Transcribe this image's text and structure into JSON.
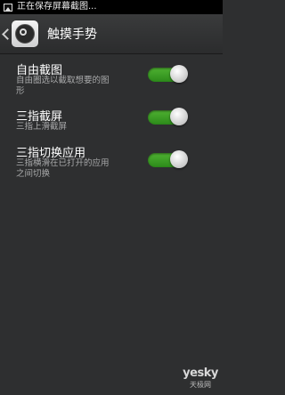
{
  "status_bar": {
    "text": "正在保存屏幕截图..."
  },
  "title_bar": {
    "title": "触摸手势"
  },
  "settings": [
    {
      "title": "自由截图",
      "desc_lines": [
        "自由圈选以截取想要的图",
        "形"
      ],
      "enabled": true
    },
    {
      "title": "三指截屏",
      "desc_lines": [
        "三指上滑截屏"
      ],
      "enabled": true
    },
    {
      "title": "三指切换应用",
      "desc_lines": [
        "三指横滑在已打开的应用",
        "之间切换"
      ],
      "enabled": true
    }
  ],
  "watermark": {
    "main": "yesky",
    "sub": "天极网"
  },
  "colors": {
    "background": "#2e2f30",
    "toggle_on": "#4fb232"
  },
  "icons": {
    "status": "picture-icon",
    "back": "chevron-left-icon",
    "app": "gesture-settings-icon"
  }
}
